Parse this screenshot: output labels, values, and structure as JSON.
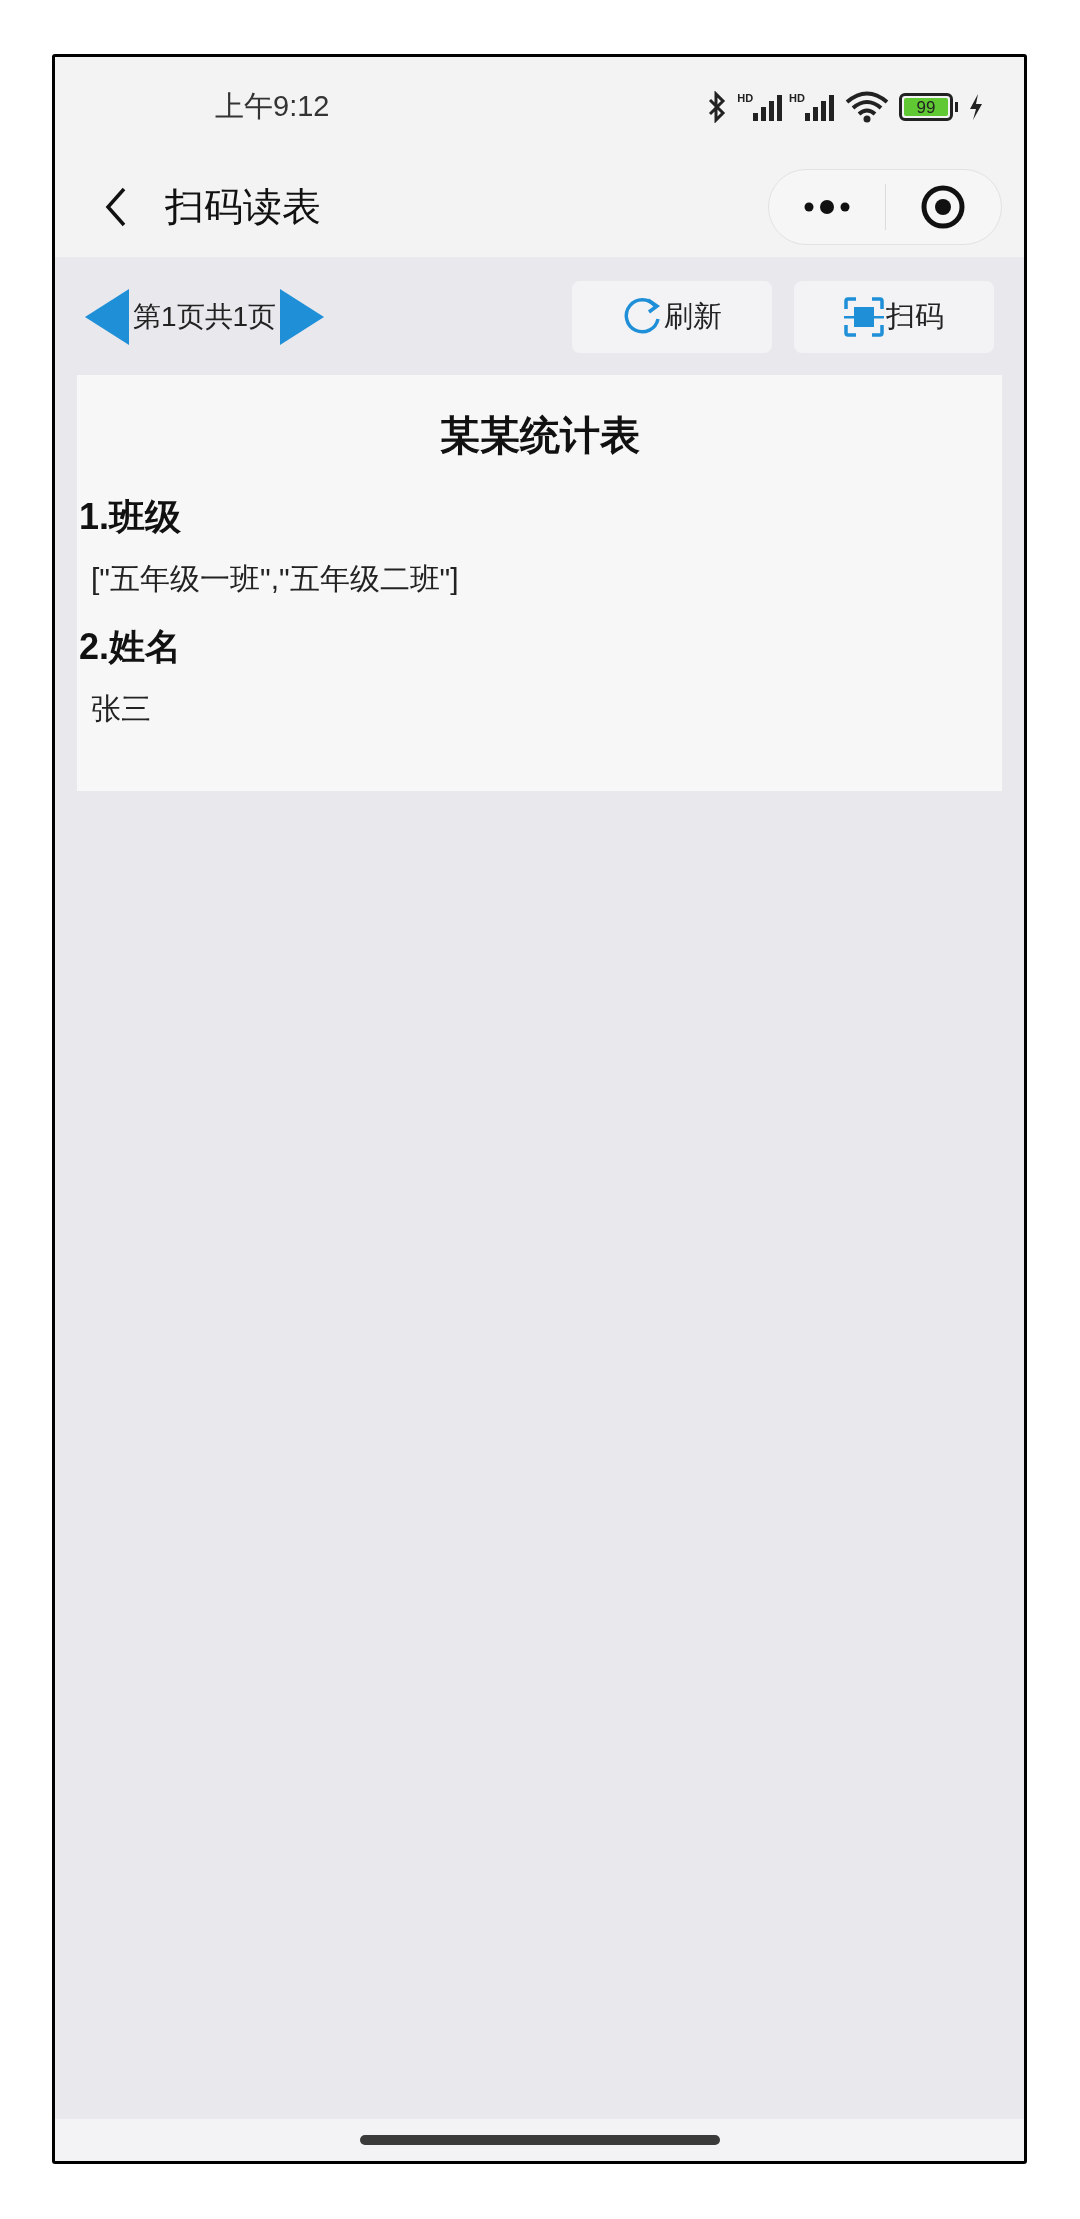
{
  "status_bar": {
    "time": "上午9:12",
    "network_labels": [
      "HD",
      "HD"
    ],
    "battery": "99",
    "charging": true
  },
  "header": {
    "title": "扫码读表"
  },
  "pager": {
    "label": "第1页共1页"
  },
  "buttons": [
    {
      "kind": "refresh",
      "label": "刷新"
    },
    {
      "kind": "scan",
      "label": "扫码"
    }
  ],
  "form": {
    "title": "某某统计表",
    "questions": [
      {
        "label": "1.班级",
        "answer": "[\"五年级一班\",\"五年级二班\"]"
      },
      {
        "label": "2.姓名",
        "answer": "张三"
      }
    ]
  }
}
